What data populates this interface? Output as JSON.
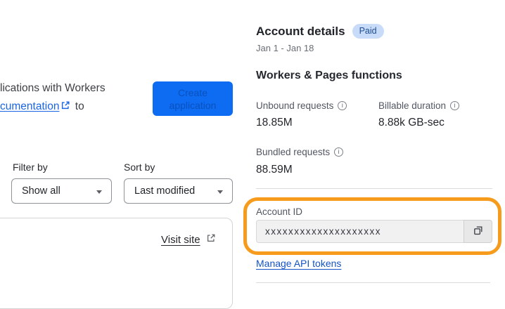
{
  "left": {
    "intro_line1": "lications with Workers",
    "intro_link": "cumentation",
    "intro_suffix": "to",
    "create_button": {
      "line1": "Create",
      "line2": "application"
    },
    "filter_label": "Filter by",
    "filter_value": "Show all",
    "sort_label": "Sort by",
    "sort_value": "Last modified",
    "visit_site_label": "Visit site"
  },
  "account": {
    "title": "Account details",
    "badge": "Paid",
    "date_range": "Jan 1 - Jan 18",
    "section_title": "Workers & Pages functions",
    "stats": [
      {
        "label": "Unbound requests",
        "value": "18.85M"
      },
      {
        "label": "Billable duration",
        "value": "8.88k GB-sec"
      },
      {
        "label": "Bundled requests",
        "value": "88.59M"
      }
    ],
    "account_id": {
      "label": "Account ID",
      "value": "xxxxxxxxxxxxxxxxxxxx"
    },
    "manage_link": "Manage API tokens"
  },
  "colors": {
    "primary_blue": "#0d6cf2",
    "link_blue": "#1a64e6",
    "manage_link_blue": "#1353c5",
    "badge_bg": "#c8dcf9",
    "badge_text": "#1d4d8f",
    "annotation_orange": "#f79b1d"
  }
}
